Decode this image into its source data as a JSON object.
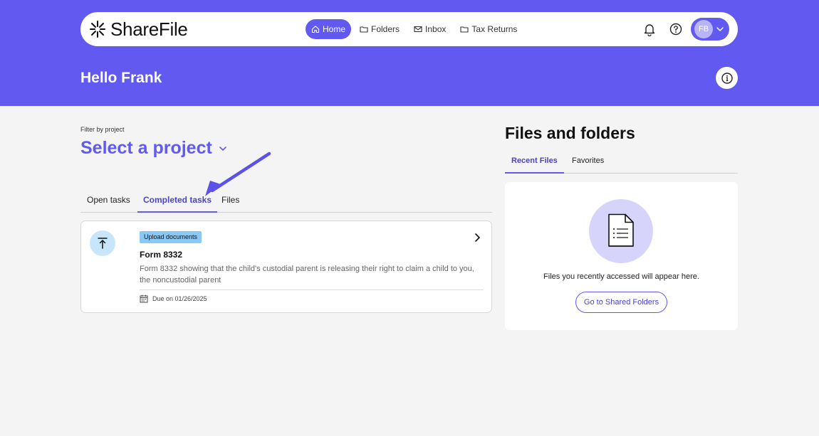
{
  "app": {
    "brand": "ShareFile",
    "accent_color": "#6159f0"
  },
  "nav": {
    "items": [
      {
        "label": "Home",
        "icon": "home-icon",
        "active": true
      },
      {
        "label": "Folders",
        "icon": "folder-icon",
        "active": false
      },
      {
        "label": "Inbox",
        "icon": "mail-icon",
        "active": false
      },
      {
        "label": "Tax Returns",
        "icon": "folder-icon",
        "active": false
      }
    ],
    "user_initials": "FB"
  },
  "header": {
    "greeting": "Hello Frank"
  },
  "project_filter": {
    "label": "Filter by project",
    "value": "Select a project"
  },
  "task_tabs": [
    {
      "label": "Open tasks",
      "active": false
    },
    {
      "label": "Completed tasks",
      "active": true
    },
    {
      "label": "Files",
      "active": false
    }
  ],
  "task": {
    "badge": "Upload documents",
    "title": "Form 8332",
    "description": "Form 8332 showing that the child's custodial parent is releasing their right to claim a child to you, the noncustodial parent",
    "due": "Due on 01/26/2025"
  },
  "files_panel": {
    "title": "Files and folders",
    "tabs": [
      {
        "label": "Recent Files",
        "active": true
      },
      {
        "label": "Favorites",
        "active": false
      }
    ],
    "empty_message": "Files you recently accessed will appear here.",
    "button_label": "Go to Shared Folders"
  }
}
